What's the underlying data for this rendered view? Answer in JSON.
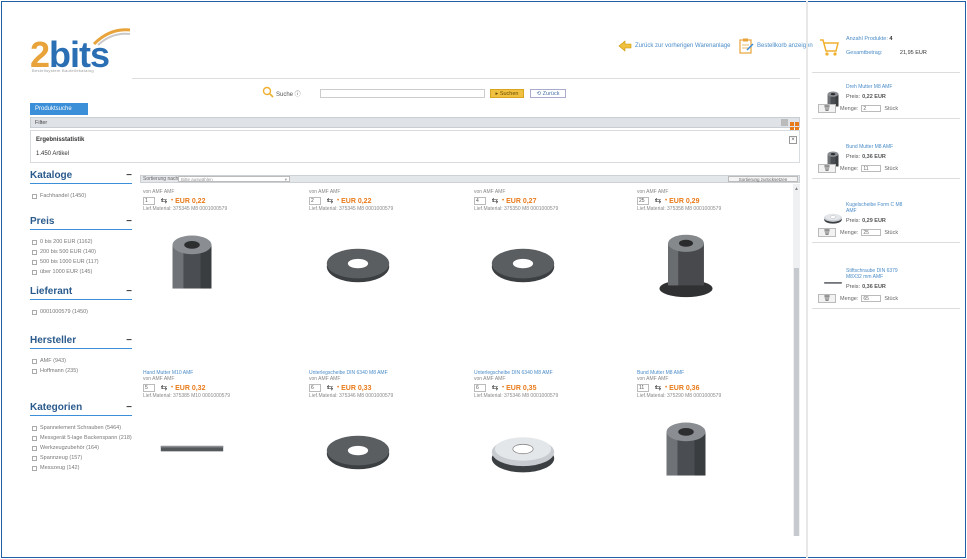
{
  "header": {
    "logo_text": "2bits",
    "logo_subtitle": "Bestellsystem Bauteilekatalog",
    "nav_links": [
      {
        "label": "Zurück zur vorherigen Warenanlage",
        "icon": "back-arrow-icon"
      },
      {
        "label": "Bestellkorb anzeigen",
        "icon": "clipboard-icon"
      }
    ]
  },
  "search": {
    "label": "Suche",
    "value": "",
    "submit_label": "Suchen",
    "reset_label": "Zurück"
  },
  "tab": {
    "label": "Produktsuche"
  },
  "filter": {
    "label": "Filter",
    "results_label": "Ergebnisstatistik",
    "results_count": "1.450",
    "results_suffix": "Artikel"
  },
  "facets": [
    {
      "title": "Kataloge",
      "items": [
        "Fachhandel (1450)"
      ]
    },
    {
      "title": "Preis",
      "items": [
        "0 bis 200 EUR (1162)",
        "200 bis 500 EUR (140)",
        "500 bis 1000 EUR (117)",
        "über 1000 EUR (145)"
      ]
    },
    {
      "title": "Lieferant",
      "items": [
        "0001000579 (1450)"
      ]
    },
    {
      "title": "Hersteller",
      "items": [
        "AMF (943)",
        "Hoffmann (235)"
      ]
    },
    {
      "title": "Kategorien",
      "items": [
        "Spannelement Schrauben (5464)",
        "Messgerät 5-lage Backenspann (218)",
        "Werkzeugzubehör (164)",
        "Spannzeug (157)",
        "Messzeug (142)"
      ]
    }
  ],
  "sort": {
    "label": "Sortierung nach:",
    "placeholder": "Bitte auswählen",
    "reset_label": "Sortierung zurücksetzen"
  },
  "products": [
    {
      "title": "",
      "vendor": "von AMF AMF",
      "qty": "1",
      "price": "EUR 0,22",
      "article": "Lief.Material: 375345 M8 0001000579",
      "image": "hex-nut"
    },
    {
      "title": "",
      "vendor": "von AMF AMF",
      "qty": "2",
      "price": "EUR 0,22",
      "article": "Lief.Material: 375345 M8 0001000579",
      "image": "washer"
    },
    {
      "title": "",
      "vendor": "von AMF AMF",
      "qty": "4",
      "price": "EUR 0,27",
      "article": "Lief.Material: 375350 M8 0001000579",
      "image": "washer"
    },
    {
      "title": "",
      "vendor": "von AMF AMF",
      "qty": "25",
      "price": "EUR 0,29",
      "article": "Lief.Material: 375358 M8 0001000579",
      "image": "flange-nut"
    },
    {
      "title": "Hand Mutter M10 AMF",
      "vendor": "von AMF AMF",
      "qty": "5",
      "price": "EUR 0,32",
      "article": "Lief.Material: 375385 M10 0001000579",
      "image": "threaded-rod"
    },
    {
      "title": "Unterlegscheibe DIN 6340 M8 AMF",
      "vendor": "von AMF AMF",
      "qty": "6",
      "price": "EUR 0,33",
      "article": "Lief.Material: 375346 M8 0001000579",
      "image": "washer"
    },
    {
      "title": "Unterlegscheibe DIN 6340 M8 AMF",
      "vendor": "von AMF AMF",
      "qty": "6",
      "price": "EUR 0,35",
      "article": "Lief.Material: 375346 M8 0001000579",
      "image": "spherical-washer"
    },
    {
      "title": "Bund Mutter M8 AMF",
      "vendor": "von AMF AMF",
      "qty": "11",
      "price": "EUR 0,36",
      "article": "Lief.Material: 375290 M8 0001000579",
      "image": "hex-nut"
    }
  ],
  "cart": {
    "count_label": "Anzahl Produkte:",
    "count_value": "4",
    "total_label": "Gesamtbetrag:",
    "total_value": "21,95 EUR",
    "price_label": "Preis:",
    "qty_label": "Menge:",
    "unit_label": "Stück",
    "items": [
      {
        "title": "Dreh Mutter M8 AMF",
        "price": "0,22 EUR",
        "qty": "2",
        "image": "hex-nut"
      },
      {
        "title": "Bund Mutter M8 AMF",
        "price": "0,36 EUR",
        "qty": "11",
        "image": "hex-nut"
      },
      {
        "title": "Kugelscheibe Form C M8 AMF",
        "price": "0,29 EUR",
        "qty": "25",
        "image": "spherical-washer"
      },
      {
        "title": "Stiftschraube DIN 6379 M8X32 mm AMF",
        "price": "0,36 EUR",
        "qty": "65",
        "image": "threaded-rod"
      }
    ]
  },
  "colors": {
    "accent": "#3b8ed8",
    "price": "#e87a1a",
    "frame": "#1e5fa6",
    "logo_orange": "#e8a33a",
    "logo_blue": "#2a6fb3"
  }
}
